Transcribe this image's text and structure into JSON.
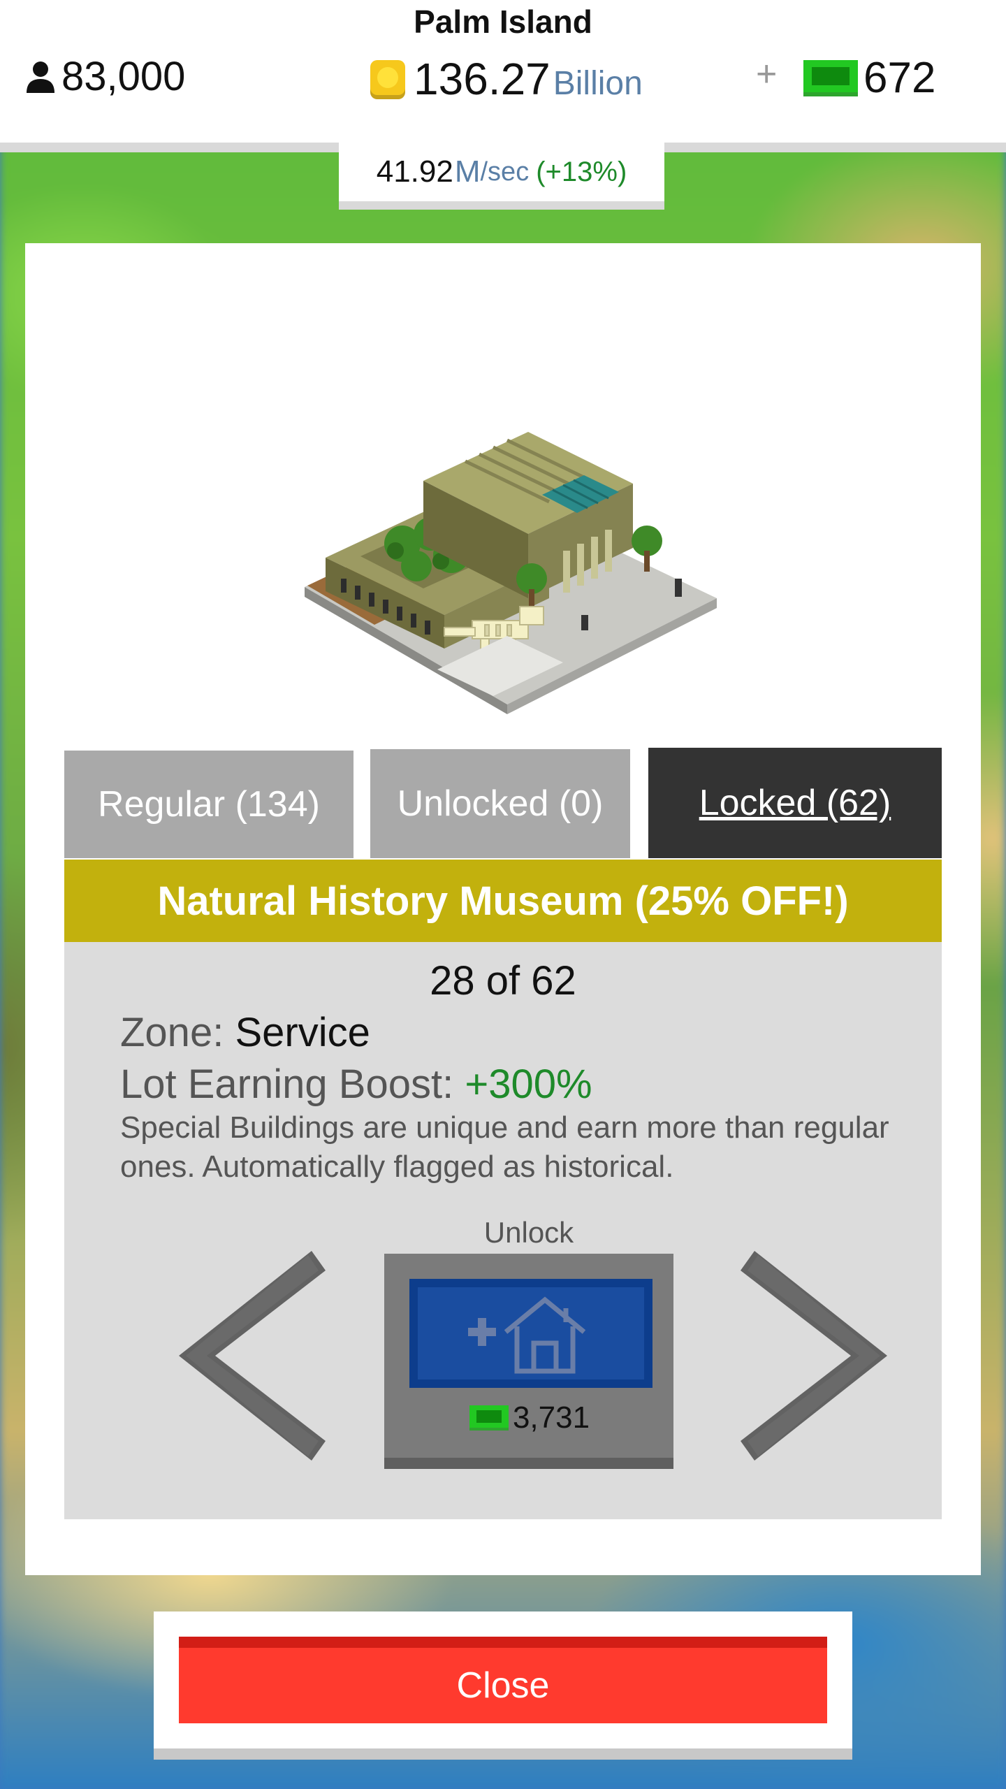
{
  "header": {
    "island_name": "Palm Island",
    "population": "83,000",
    "coins_value": "136.27",
    "coins_unit": "Billion",
    "plus": "+",
    "cash": "672"
  },
  "income": {
    "rate_value": "41.92",
    "rate_unit": "M",
    "rate_per": "/sec",
    "rate_boost": "(+13%)"
  },
  "tabs": [
    {
      "label": "Regular (134)"
    },
    {
      "label": "Unlocked (0)"
    },
    {
      "label": "Locked (62)",
      "selected": true
    }
  ],
  "building": {
    "title": "Natural History Museum (25% OFF!)",
    "counter": "28 of 62",
    "zone_label": "Zone:",
    "zone_value": "Service",
    "boost_label": "Lot Earning Boost:",
    "boost_value": "+300%",
    "description": "Special Buildings are unique and earn more than regular ones. Automatically flagged as historical."
  },
  "unlock": {
    "label": "Unlock",
    "price": "3,731"
  },
  "close_label": "Close",
  "colors": {
    "title_bar": "#c2b10d",
    "selected_tab": "#333333",
    "tab": "#a9a9a9",
    "close": "#ff3a2e",
    "unlock": "#1a4da0",
    "boost_green": "#1e8a2a"
  }
}
